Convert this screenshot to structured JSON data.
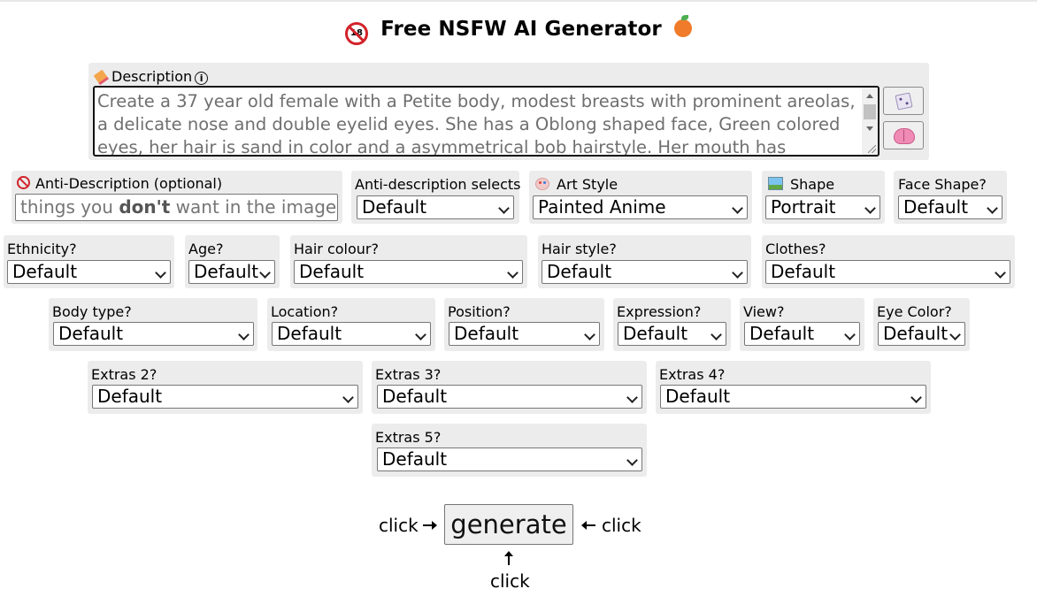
{
  "title": "Free NSFW AI Generator",
  "title_icons": [
    "no-under-18-icon",
    "peach-icon"
  ],
  "description": {
    "label": "Description",
    "value": "Create a 37 year old female with a Petite body, modest breasts with prominent areolas, a delicate nose and double eyelid eyes. She has a Oblong shaped face, Green colored eyes, her hair is sand in color and a asymmetrical bob hairstyle. Her mouth has upturned lips",
    "icons": [
      "pencil-icon",
      "info-icon",
      "dice-icon",
      "brain-icon"
    ]
  },
  "anti_description": {
    "label": "Anti-Description (optional)",
    "placeholder_before": "things you ",
    "placeholder_bold": "don't",
    "placeholder_after": " want in the image"
  },
  "selects": {
    "anti_selects": {
      "label": "Anti-description selects",
      "value": "Default"
    },
    "art_style": {
      "label": "Art Style",
      "value": "Painted Anime"
    },
    "shape": {
      "label": "Shape",
      "value": "Portrait"
    },
    "face_shape": {
      "label": "Face Shape?",
      "value": "Default"
    },
    "ethnicity": {
      "label": "Ethnicity?",
      "value": "Default"
    },
    "age": {
      "label": "Age?",
      "value": "Default"
    },
    "hair_colour": {
      "label": "Hair colour?",
      "value": "Default"
    },
    "hair_style": {
      "label": "Hair style?",
      "value": "Default"
    },
    "clothes": {
      "label": "Clothes?",
      "value": "Default"
    },
    "body_type": {
      "label": "Body type?",
      "value": "Default"
    },
    "location": {
      "label": "Location?",
      "value": "Default"
    },
    "position": {
      "label": "Position?",
      "value": "Default"
    },
    "expression": {
      "label": "Expression?",
      "value": "Default"
    },
    "view": {
      "label": "View?",
      "value": "Default"
    },
    "eye_color": {
      "label": "Eye Color?",
      "value": "Default"
    },
    "extras2": {
      "label": "Extras 2?",
      "value": "Default"
    },
    "extras3": {
      "label": "Extras 3?",
      "value": "Default"
    },
    "extras4": {
      "label": "Extras 4?",
      "value": "Default"
    },
    "extras5": {
      "label": "Extras 5?",
      "value": "Default"
    }
  },
  "generate": {
    "button_label": "generate",
    "hint_left": "click",
    "hint_right": "click",
    "hint_bottom": "click"
  },
  "colors": {
    "panel_bg": "#ececec",
    "prohibit_red": "#d2232a"
  }
}
